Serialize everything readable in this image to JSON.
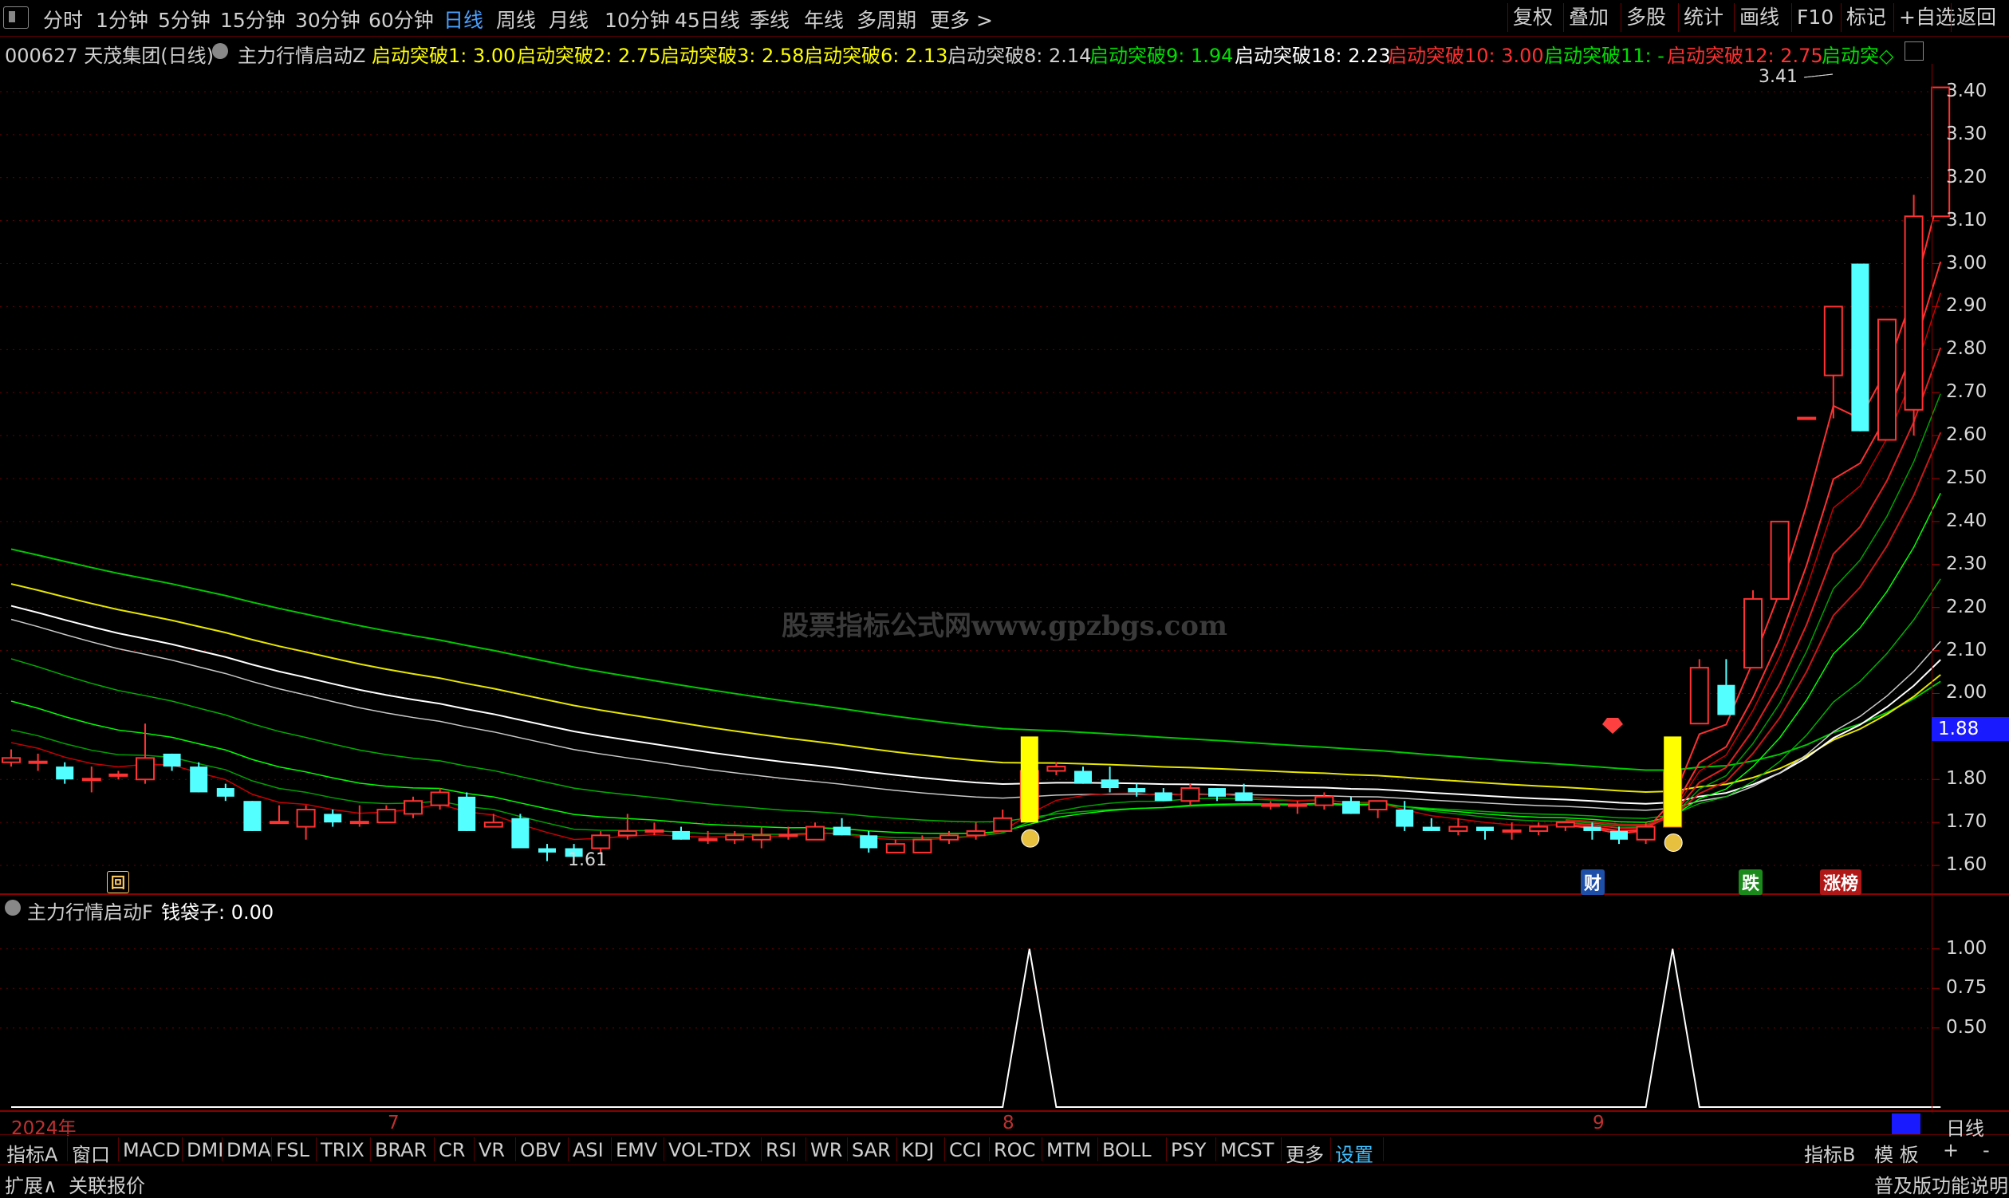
{
  "toolbar": {
    "periods": [
      "分时",
      "1分钟",
      "5分钟",
      "15分钟",
      "30分钟",
      "60分钟",
      "日线",
      "周线",
      "月线",
      "10分钟",
      "45日线",
      "季线",
      "年线",
      "多周期",
      "更多 >"
    ],
    "active_period": "日线",
    "right_buttons": [
      "复权",
      "叠加",
      "多股",
      "统计",
      "画线",
      "F10",
      "标记",
      "+自选",
      "返回"
    ]
  },
  "info": {
    "stock": "000627 天茂集团(日线)",
    "indicator": "主力行情启动Z",
    "items": [
      {
        "text": "启动突破1: 3.00",
        "color": "#ffff00"
      },
      {
        "text": "启动突破2: 2.75",
        "color": "#ffff00"
      },
      {
        "text": "启动突破3: 2.58",
        "color": "#ffff00"
      },
      {
        "text": "启动突破6: 2.13",
        "color": "#ffff00"
      },
      {
        "text": "启动突破8: 2.14",
        "color": "#d0d0d0"
      },
      {
        "text": "启动突破9: 1.94",
        "color": "#00e000"
      },
      {
        "text": "启动突破18: 2.23",
        "color": "#ffffff"
      },
      {
        "text": "启动突破10: 3.00",
        "color": "#ff3030"
      },
      {
        "text": "启动突破11: -",
        "color": "#00e000"
      },
      {
        "text": "启动突破12: 2.75",
        "color": "#ff3030"
      },
      {
        "text": "启动突◇",
        "color": "#00e000"
      }
    ]
  },
  "sub_info": {
    "indicator": "主力行情启动F",
    "value": "钱袋子: 0.00"
  },
  "watermark": "股票指标公式网www.gpzbgs.com",
  "price_axis": [
    "3.40",
    "3.30",
    "3.20",
    "3.10",
    "3.00",
    "2.90",
    "2.80",
    "2.70",
    "2.60",
    "2.50",
    "2.40",
    "2.30",
    "2.20",
    "2.10",
    "2.00",
    "1.80",
    "1.70",
    "1.60"
  ],
  "sub_axis": [
    "1.00",
    "0.75",
    "0.50"
  ],
  "current_price": "1.88",
  "high_label": "3.41",
  "low_label": "1.61",
  "date_labels": [
    "2024年",
    "7",
    "8",
    "9"
  ],
  "markers": {
    "hui": "回",
    "cai": "财",
    "die": "跌",
    "zhang": "涨榜"
  },
  "bottom_tabs": [
    "指标A",
    "窗口",
    "MACD",
    "DMI",
    "DMA",
    "FSL",
    "TRIX",
    "BRAR",
    "CR",
    "VR",
    "OBV",
    "ASI",
    "EMV",
    "VOL-TDX",
    "RSI",
    "WR",
    "SAR",
    "KDJ",
    "CCI",
    "ROC",
    "MTM",
    "BOLL",
    "PSY",
    "MCST",
    "更多",
    "设置"
  ],
  "bottom_right": [
    "指标B",
    "模 板",
    "+",
    "-"
  ],
  "period_label": "日线",
  "status_left": [
    "扩展∧",
    "关联报价"
  ],
  "status_right": "普及版功能说明",
  "colors": {
    "up": "#ff3232",
    "down": "#54ffff",
    "signal": "#ffff00"
  },
  "chart_data": {
    "type": "candlestick",
    "candles": [
      [
        1.84,
        1.85,
        1.87,
        1.83
      ],
      [
        1.84,
        1.84,
        1.86,
        1.82
      ],
      [
        1.83,
        1.8,
        1.84,
        1.79
      ],
      [
        1.8,
        1.8,
        1.83,
        1.77
      ],
      [
        1.81,
        1.81,
        1.82,
        1.8
      ],
      [
        1.8,
        1.85,
        1.93,
        1.79
      ],
      [
        1.86,
        1.83,
        1.86,
        1.82
      ],
      [
        1.83,
        1.77,
        1.84,
        1.77
      ],
      [
        1.78,
        1.76,
        1.79,
        1.75
      ],
      [
        1.75,
        1.68,
        1.75,
        1.68
      ],
      [
        1.7,
        1.7,
        1.74,
        1.7
      ],
      [
        1.69,
        1.73,
        1.74,
        1.66
      ],
      [
        1.72,
        1.7,
        1.73,
        1.69
      ],
      [
        1.7,
        1.7,
        1.74,
        1.69
      ],
      [
        1.7,
        1.73,
        1.74,
        1.7
      ],
      [
        1.72,
        1.75,
        1.76,
        1.71
      ],
      [
        1.74,
        1.77,
        1.78,
        1.73
      ],
      [
        1.76,
        1.68,
        1.77,
        1.68
      ],
      [
        1.69,
        1.7,
        1.72,
        1.69
      ],
      [
        1.71,
        1.64,
        1.72,
        1.64
      ],
      [
        1.64,
        1.63,
        1.65,
        1.61
      ],
      [
        1.64,
        1.62,
        1.65,
        1.61
      ],
      [
        1.64,
        1.67,
        1.68,
        1.63
      ],
      [
        1.67,
        1.68,
        1.72,
        1.66
      ],
      [
        1.68,
        1.68,
        1.7,
        1.67
      ],
      [
        1.68,
        1.66,
        1.69,
        1.66
      ],
      [
        1.66,
        1.66,
        1.68,
        1.65
      ],
      [
        1.66,
        1.67,
        1.68,
        1.65
      ],
      [
        1.66,
        1.67,
        1.69,
        1.64
      ],
      [
        1.67,
        1.67,
        1.69,
        1.66
      ],
      [
        1.66,
        1.69,
        1.7,
        1.66
      ],
      [
        1.69,
        1.67,
        1.71,
        1.67
      ],
      [
        1.67,
        1.64,
        1.68,
        1.63
      ],
      [
        1.63,
        1.65,
        1.66,
        1.63
      ],
      [
        1.63,
        1.66,
        1.67,
        1.63
      ],
      [
        1.66,
        1.67,
        1.68,
        1.65
      ],
      [
        1.67,
        1.68,
        1.7,
        1.66
      ],
      [
        1.68,
        1.71,
        1.73,
        1.68
      ],
      [
        1.71,
        1.82,
        1.85,
        1.7
      ],
      [
        1.82,
        1.83,
        1.84,
        1.81
      ],
      [
        1.82,
        1.79,
        1.83,
        1.79
      ],
      [
        1.8,
        1.78,
        1.83,
        1.77
      ],
      [
        1.78,
        1.77,
        1.79,
        1.76
      ],
      [
        1.77,
        1.75,
        1.78,
        1.75
      ],
      [
        1.75,
        1.78,
        1.79,
        1.74
      ],
      [
        1.78,
        1.76,
        1.78,
        1.75
      ],
      [
        1.77,
        1.75,
        1.79,
        1.75
      ],
      [
        1.74,
        1.74,
        1.75,
        1.73
      ],
      [
        1.74,
        1.74,
        1.75,
        1.72
      ],
      [
        1.74,
        1.76,
        1.77,
        1.73
      ],
      [
        1.75,
        1.72,
        1.76,
        1.72
      ],
      [
        1.73,
        1.75,
        1.75,
        1.71
      ],
      [
        1.73,
        1.69,
        1.75,
        1.68
      ],
      [
        1.69,
        1.68,
        1.71,
        1.68
      ],
      [
        1.68,
        1.69,
        1.71,
        1.67
      ],
      [
        1.69,
        1.68,
        1.69,
        1.66
      ],
      [
        1.68,
        1.68,
        1.7,
        1.66
      ],
      [
        1.68,
        1.69,
        1.7,
        1.67
      ],
      [
        1.69,
        1.7,
        1.7,
        1.68
      ],
      [
        1.69,
        1.68,
        1.7,
        1.66
      ],
      [
        1.68,
        1.66,
        1.69,
        1.65
      ],
      [
        1.66,
        1.69,
        1.7,
        1.65
      ],
      [
        1.69,
        1.82,
        1.83,
        1.69
      ],
      [
        1.93,
        2.06,
        2.08,
        1.93
      ],
      [
        2.02,
        1.95,
        2.08,
        1.95
      ],
      [
        2.06,
        2.22,
        2.24,
        2.06
      ],
      [
        2.22,
        2.4,
        2.4,
        2.22
      ],
      [
        2.64,
        2.64,
        2.64,
        2.64
      ],
      [
        2.74,
        2.9,
        2.9,
        2.64
      ],
      [
        3.0,
        2.61,
        3.0,
        2.61
      ],
      [
        2.59,
        2.87,
        2.87,
        2.59
      ],
      [
        2.66,
        3.11,
        3.16,
        2.6
      ],
      [
        3.11,
        3.41,
        3.41,
        3.11
      ]
    ],
    "ylim": [
      1.55,
      3.45
    ],
    "signal_days": [
      38,
      62
    ],
    "sub_series": {
      "name": "钱袋子",
      "ylim": [
        0,
        1.2
      ]
    }
  }
}
